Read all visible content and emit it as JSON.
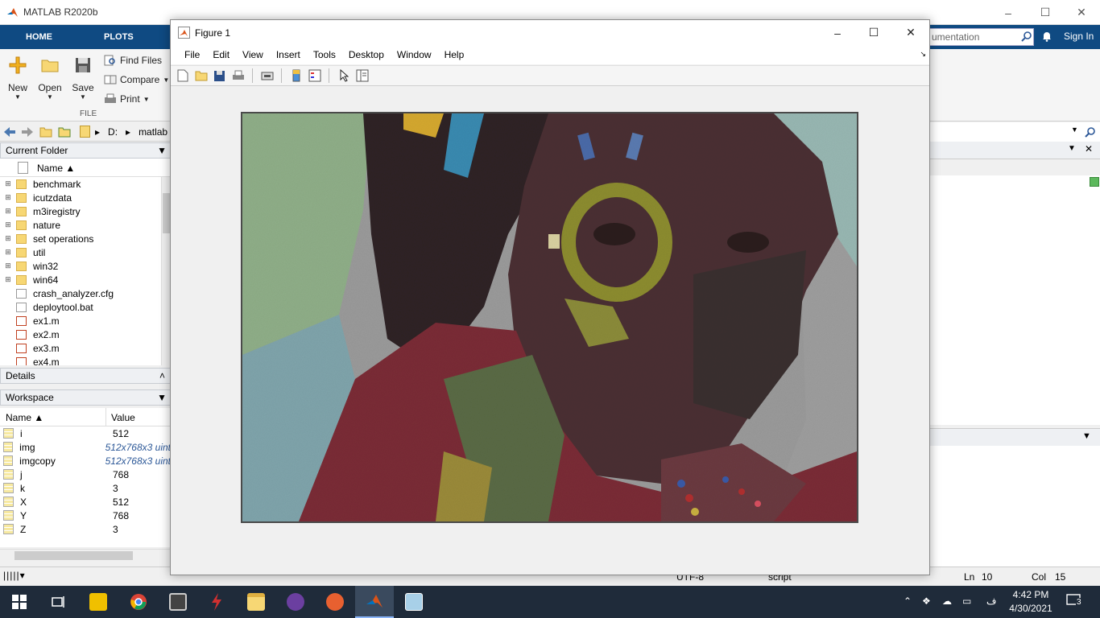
{
  "matlab": {
    "title": "MATLAB R2020b",
    "tabs": [
      "HOME",
      "PLOTS"
    ],
    "search_placeholder": "umentation",
    "signin": "Sign In",
    "ribbon": {
      "new": "New",
      "open": "Open",
      "save": "Save",
      "find_files": "Find Files",
      "compare": "Compare",
      "print": "Print",
      "group_label": "FILE"
    },
    "path": [
      "D:",
      "matlab"
    ]
  },
  "current_folder": {
    "title": "Current Folder",
    "name_col": "Name",
    "items": [
      {
        "name": "benchmark",
        "type": "folder"
      },
      {
        "name": "icutzdata",
        "type": "folder"
      },
      {
        "name": "m3iregistry",
        "type": "folder"
      },
      {
        "name": "nature",
        "type": "folder"
      },
      {
        "name": "set operations",
        "type": "folder"
      },
      {
        "name": "util",
        "type": "folder"
      },
      {
        "name": "win32",
        "type": "folder"
      },
      {
        "name": "win64",
        "type": "folder"
      },
      {
        "name": "crash_analyzer.cfg",
        "type": "file"
      },
      {
        "name": "deploytool.bat",
        "type": "bat"
      },
      {
        "name": "ex1.m",
        "type": "mfile"
      },
      {
        "name": "ex2.m",
        "type": "mfile"
      },
      {
        "name": "ex3.m",
        "type": "mfile"
      },
      {
        "name": "ex4.m",
        "type": "mfile"
      }
    ]
  },
  "details": {
    "title": "Details"
  },
  "workspace": {
    "title": "Workspace",
    "name_col": "Name",
    "value_col": "Value",
    "vars": [
      {
        "name": "i",
        "value": "512"
      },
      {
        "name": "img",
        "value": "512x768x3 uint"
      },
      {
        "name": "imgcopy",
        "value": "512x768x3 uint"
      },
      {
        "name": "j",
        "value": "768"
      },
      {
        "name": "k",
        "value": "3"
      },
      {
        "name": "X",
        "value": "512"
      },
      {
        "name": "Y",
        "value": "768"
      },
      {
        "name": "Z",
        "value": "3"
      }
    ]
  },
  "status": {
    "encoding": "UTF-8",
    "mode": "script",
    "ln_label": "Ln",
    "ln": "10",
    "col_label": "Col",
    "col": "15"
  },
  "figure": {
    "title": "Figure 1",
    "menu": [
      "File",
      "Edit",
      "View",
      "Insert",
      "Tools",
      "Desktop",
      "Window",
      "Help"
    ]
  },
  "taskbar": {
    "time": "4:42 PM",
    "date": "4/30/2021",
    "notifications": "3",
    "lang": "ف"
  }
}
